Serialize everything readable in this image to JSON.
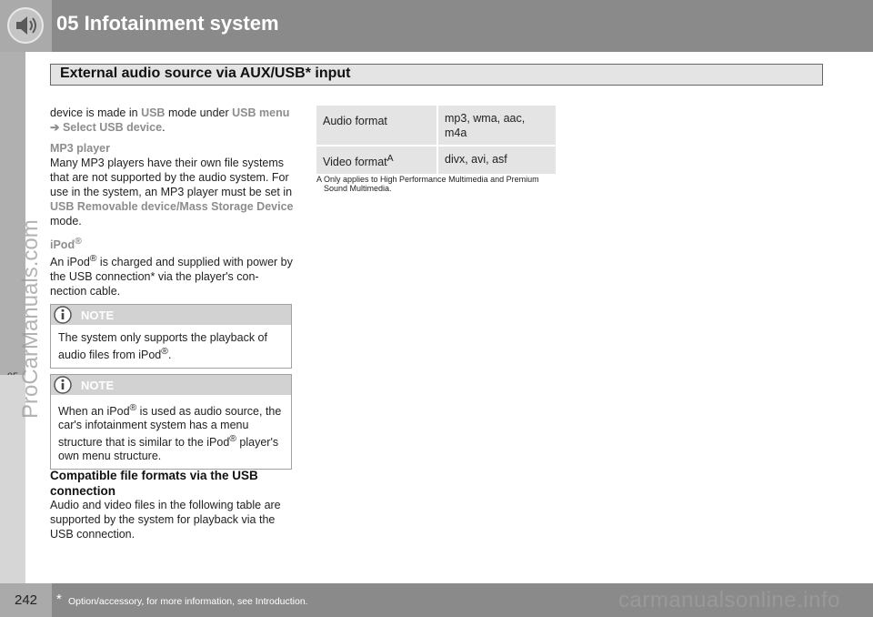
{
  "header": {
    "chapter_title": "05  Infotainment system",
    "icon": "speaker-icon"
  },
  "side_tab": {
    "chapter_number": "05"
  },
  "watermarks": {
    "side": "ProCarManuals.com",
    "bottom": "carmanualsonline.info"
  },
  "section": {
    "title": "External audio source via AUX/USB* input"
  },
  "left_column": {
    "intro": {
      "t1": "device is made in ",
      "usb": "USB",
      "t2": " mode under ",
      "usb_menu": "USB menu",
      "arrow": "➔",
      "select_device": "Select USB device",
      "t3": "."
    },
    "mp3_heading": "MP3 player",
    "mp3": {
      "t1": "Many MP3 players have their own file systems that are not supported by the audio system. For use in the system, an MP3 player must be set in ",
      "mode_name": "USB Removable device/Mass Storage Device",
      "t2": " mode."
    },
    "ipod_heading": "iPod",
    "ipod_heading_reg": "®",
    "ipod": {
      "t1": "An iPod",
      "reg": "®",
      "t2": " is charged and supplied with power by the USB connection* via the player's con-nection cable."
    }
  },
  "notes": [
    {
      "label": "NOTE",
      "icon": "info-icon",
      "t1": "The system only supports the playback of audio files from iPod",
      "reg": "®",
      "t2": "."
    },
    {
      "label": "NOTE",
      "icon": "info-icon",
      "t1": "When an iPod",
      "reg1": "®",
      "t2": " is used as audio source, the car's infotainment system has a menu structure that is similar to the iPod",
      "reg2": "®",
      "t3": " player's own menu structure."
    }
  ],
  "compat": {
    "heading": "Compatible file formats via the USB connection",
    "text": "Audio and video files in the following table are supported by the system for playback via the USB connection."
  },
  "format_table": {
    "rows": [
      {
        "label": "Audio format",
        "sup": "",
        "value": "mp3, wma, aac, m4a"
      },
      {
        "label": "Video format",
        "sup": "A",
        "value": "divx, avi, asf"
      }
    ],
    "footnote_mark": "A",
    "footnote": "Only applies to High Performance Multimedia and Premium Sound Multimedia."
  },
  "footer": {
    "page_number": "242",
    "star": "*",
    "note": "Option/accessory, for more information, see Introduction."
  }
}
